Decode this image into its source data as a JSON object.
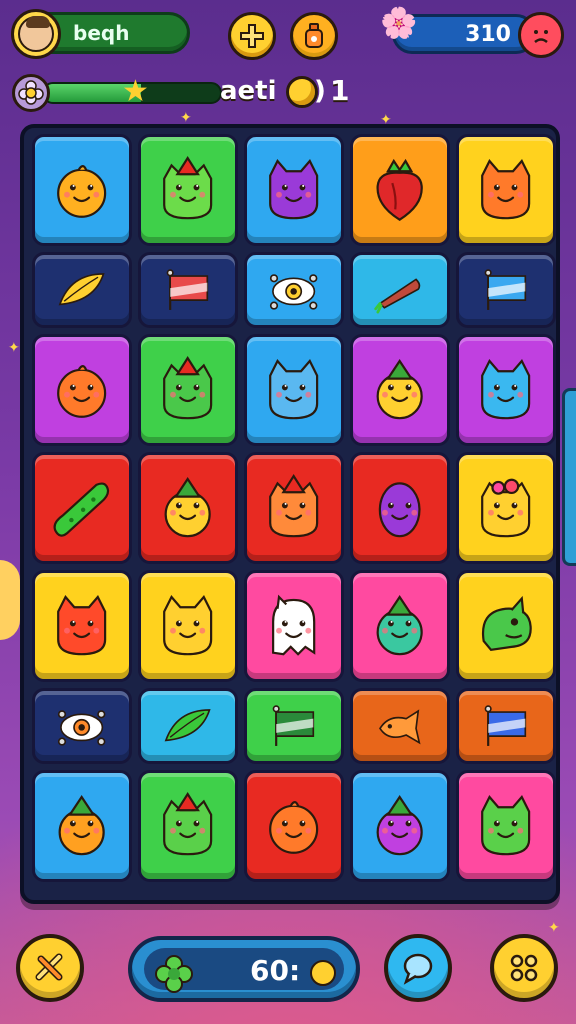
{
  "header": {
    "player_name": "beqh",
    "score": "310",
    "icons": [
      "avatar",
      "plus-icon",
      "potion-icon",
      "flower-icon",
      "sad-face-icon"
    ]
  },
  "progress": {
    "fraction": 0.55,
    "level_label": "aeti",
    "coin_paren": ")",
    "coin_count": "1",
    "icons": [
      "flower-badge-icon",
      "star-icon",
      "coin-icon"
    ]
  },
  "board": {
    "rows": [
      {
        "size": "big",
        "tiles": [
          {
            "color": "#2fa8f0",
            "piece": "blob",
            "fg": "#ffb020"
          },
          {
            "color": "#3fd04a",
            "piece": "cat-hat",
            "fg": "#6cdc4a"
          },
          {
            "color": "#2fa8f0",
            "piece": "cat",
            "fg": "#9a3ad8"
          },
          {
            "color": "#ff9e1a",
            "piece": "strawberry",
            "fg": "#e0282a"
          },
          {
            "color": "#ffd21e",
            "piece": "cat",
            "fg": "#ff7a2a"
          }
        ]
      },
      {
        "size": "small",
        "tiles": [
          {
            "color": "#1e3070",
            "piece": "leaf",
            "fg": "#ffd030"
          },
          {
            "color": "#1e3070",
            "piece": "flag",
            "fg": "#e84a4a"
          },
          {
            "color": "#2fa8f0",
            "piece": "eye",
            "fg": "#ffd030"
          },
          {
            "color": "#2fb8e8",
            "piece": "carrot",
            "fg": "#c04a3a"
          },
          {
            "color": "#1e3070",
            "piece": "flag",
            "fg": "#3aa8f0"
          }
        ]
      },
      {
        "size": "big",
        "tiles": [
          {
            "color": "#c040e0",
            "piece": "blob",
            "fg": "#ff7a2a"
          },
          {
            "color": "#3fd04a",
            "piece": "cat-hat",
            "fg": "#4ac84a"
          },
          {
            "color": "#2fa8f0",
            "piece": "cat",
            "fg": "#5ab8f0"
          },
          {
            "color": "#c040e0",
            "piece": "blob-hat",
            "fg": "#ffd030"
          },
          {
            "color": "#c040e0",
            "piece": "cat",
            "fg": "#3ab8f0"
          }
        ]
      },
      {
        "size": "big",
        "tiles": [
          {
            "color": "#e82a22",
            "piece": "pickle",
            "fg": "#3ac83a"
          },
          {
            "color": "#e82a22",
            "piece": "blob-hat",
            "fg": "#ffd030"
          },
          {
            "color": "#e82a22",
            "piece": "cat-hat",
            "fg": "#ff8a3a"
          },
          {
            "color": "#e82a22",
            "piece": "egg",
            "fg": "#9a3ad8"
          },
          {
            "color": "#ffd21e",
            "piece": "cat-flower",
            "fg": "#ffd030"
          }
        ]
      },
      {
        "size": "big",
        "tiles": [
          {
            "color": "#ffd21e",
            "piece": "cat",
            "fg": "#ff4a2a"
          },
          {
            "color": "#ffd21e",
            "piece": "cat",
            "fg": "#ffd030"
          },
          {
            "color": "#ff4aa0",
            "piece": "ghost",
            "fg": "#ffffff"
          },
          {
            "color": "#ff4aa0",
            "piece": "blob-hat",
            "fg": "#3ac8a0"
          },
          {
            "color": "#ffd21e",
            "piece": "chameleon",
            "fg": "#4ac84a"
          }
        ]
      },
      {
        "size": "small",
        "tiles": [
          {
            "color": "#1e3070",
            "piece": "eye",
            "fg": "#ff8a2a"
          },
          {
            "color": "#2fb8e8",
            "piece": "leaf",
            "fg": "#3ac83a"
          },
          {
            "color": "#3fd04a",
            "piece": "flag",
            "fg": "#2a8a3a"
          },
          {
            "color": "#e8661a",
            "piece": "fish",
            "fg": "#ff9a3a"
          },
          {
            "color": "#e8661a",
            "piece": "flag",
            "fg": "#3a6ae8"
          }
        ]
      },
      {
        "size": "big",
        "tiles": [
          {
            "color": "#2fa8f0",
            "piece": "blob-hat",
            "fg": "#ffa020"
          },
          {
            "color": "#3fd04a",
            "piece": "cat-hat",
            "fg": "#5ad04a"
          },
          {
            "color": "#e82a22",
            "piece": "blob",
            "fg": "#ff7a2a"
          },
          {
            "color": "#2fa8f0",
            "piece": "blob-hat",
            "fg": "#c040e0"
          },
          {
            "color": "#ff4aa0",
            "piece": "cat",
            "fg": "#5ad04a"
          }
        ]
      }
    ]
  },
  "footer": {
    "moves_value": "60:",
    "icons": [
      "swap-icon",
      "clover-icon",
      "coin-icon",
      "chat-icon",
      "menu-grid-icon"
    ]
  }
}
